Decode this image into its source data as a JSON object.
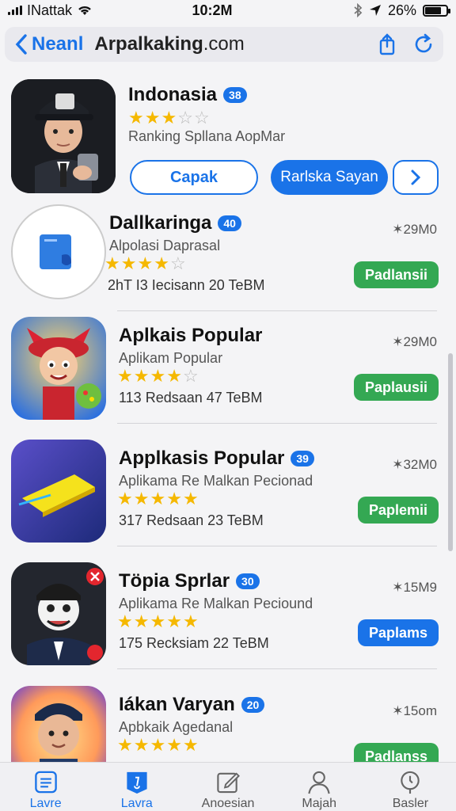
{
  "status": {
    "carrier": "INattak",
    "time": "10:2M",
    "battery": "26%",
    "battery_level": 0.75
  },
  "nav": {
    "back_label": "Neanl",
    "url_bold": "Arpalkaking",
    "url_rest": ".com"
  },
  "featured": {
    "name": "Indonasia",
    "badge": "38",
    "rating": 3,
    "subtitle": "Ranking Spllana AopMar",
    "outline_button": "Capak",
    "filled_button": "Rarlska Sayan"
  },
  "apps": [
    {
      "name": "Dallkaringa",
      "badge": "40",
      "subtitle": "Alpolasi Daprasal",
      "rating": 4,
      "meta": "2hT I3 Iecisann 20 TeBM",
      "rank": "29M0",
      "button": "Padlansii",
      "button_color": "#34a853"
    },
    {
      "name": "Aplkais Popular",
      "badge": "",
      "subtitle": "Aplikam Popular",
      "rating": 4,
      "meta": "113 Redsaan 47 TeBM",
      "rank": "29M0",
      "button": "Paplausii",
      "button_color": "#34a853"
    },
    {
      "name": "Applkasis Popular",
      "badge": "39",
      "subtitle": "Aplikama Re Malkan Pecionad",
      "rating": 4.5,
      "meta": "317 Redsaan 23 TeBM",
      "rank": "32M0",
      "button": "Paplemii",
      "button_color": "#34a853"
    },
    {
      "name": "Töpia Sprlar",
      "badge": "30",
      "subtitle": "Aplikama Re Malkan Peciound",
      "rating": 4.5,
      "meta": "175 Recksiam 22 TeBM",
      "rank": "15M9",
      "button": "Paplams",
      "button_color": "#1a73e8"
    },
    {
      "name": "Iákan Varyan",
      "badge": "20",
      "subtitle": "Apbkaik Agedanal",
      "rating": 4.5,
      "meta": "",
      "rank": "15om",
      "button": "Padlanss",
      "button_color": "#34a853"
    }
  ],
  "tabs": [
    {
      "label": "Lavre",
      "icon": "list-icon"
    },
    {
      "label": "Lavra",
      "icon": "featured-icon"
    },
    {
      "label": "Anoesian",
      "icon": "edit-icon"
    },
    {
      "label": "Majah",
      "icon": "person-icon"
    },
    {
      "label": "Basler",
      "icon": "search-icon"
    }
  ]
}
